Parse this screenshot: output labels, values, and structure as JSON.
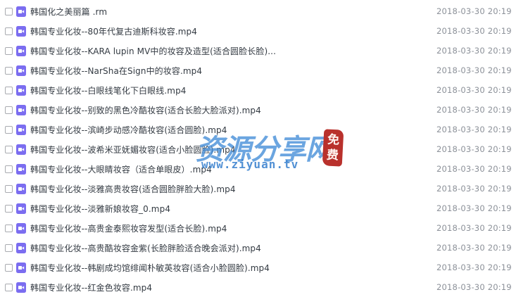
{
  "files": [
    {
      "name": "韩国化之美丽篇    .rm",
      "date": "2018-03-30 20:19"
    },
    {
      "name": "韩国专业化妆--80年代复古迪斯科妆容.mp4",
      "date": "2018-03-30 20:19"
    },
    {
      "name": "韩国专业化妆--KARA lupin MV中的妆容及造型(适合圆脸长脸)...",
      "date": "2018-03-30 20:19"
    },
    {
      "name": "韩国专业化妆--NarSha在Sign中的妆容.mp4",
      "date": "2018-03-30 20:19"
    },
    {
      "name": "韩国专业化妆--白眼线笔化下白眼线.mp4",
      "date": "2018-03-30 20:19"
    },
    {
      "name": "韩国专业化妆--别致的黑色冷酷妆容(适合长脸大脸派对).mp4",
      "date": "2018-03-30 20:19"
    },
    {
      "name": "韩国专业化妆--滨崎步动感冷酷妆容(适合圆脸).mp4",
      "date": "2018-03-30 20:19"
    },
    {
      "name": "韩国专业化妆--波希米亚妩媚妆容(适合小脸圆脸).mp4",
      "date": "2018-03-30 20:19"
    },
    {
      "name": "韩国专业化妆--大眼睛妆容（适合单眼皮）.mp4",
      "date": "2018-03-30 20:19"
    },
    {
      "name": "韩国专业化妆--淡雅高贵妆容(适合圆脸胖脸大脸).mp4",
      "date": "2018-03-30 20:19"
    },
    {
      "name": "韩国专业化妆--淡雅新娘妆容_0.mp4",
      "date": "2018-03-30 20:19"
    },
    {
      "name": "韩国专业化妆--高贵金泰熙妆容发型(适合长脸).mp4",
      "date": "2018-03-30 20:19"
    },
    {
      "name": "韩国专业化妆--高贵酷妆容金紫(长脸胖脸适合晚会派对).mp4",
      "date": "2018-03-30 20:19"
    },
    {
      "name": "韩国专业化妆--韩剧成均馆绯闻朴敏英妆容(适合小脸圆脸).mp4",
      "date": "2018-03-30 20:19"
    },
    {
      "name": "韩国专业化妆--红金色妆容.mp4",
      "date": "2018-03-30 20:19"
    }
  ],
  "watermark": {
    "title": "资源分享网",
    "url": "www.ziyuan.tv",
    "seal_top": "免",
    "seal_bottom": "费"
  },
  "colors": {
    "video_icon": "#7b6df0",
    "text": "#333a42",
    "date": "#8c9199"
  }
}
